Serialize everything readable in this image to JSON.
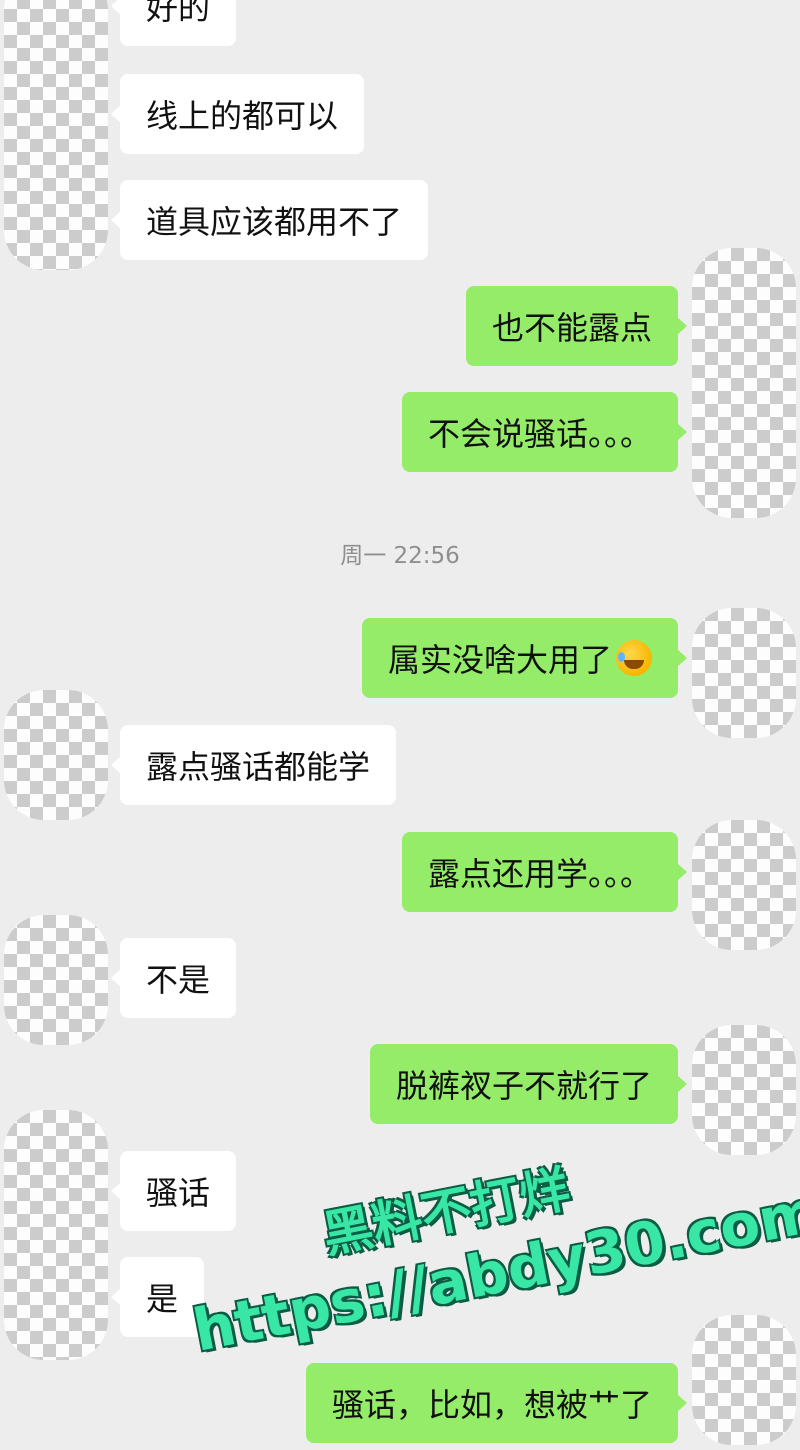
{
  "chat": {
    "messages": [
      {
        "side": "in",
        "text": "好的"
      },
      {
        "side": "in",
        "text": "线上的都可以"
      },
      {
        "side": "in",
        "text": "道具应该都用不了"
      },
      {
        "side": "out",
        "text": "也不能露点"
      },
      {
        "side": "out",
        "text": "不会说骚话。。。"
      },
      {
        "side": "out",
        "text": "属实没啥大用了",
        "emoji": "laughing-crying-emoji"
      },
      {
        "side": "in",
        "text": "露点骚话都能学"
      },
      {
        "side": "out",
        "text": "露点还用学。。。"
      },
      {
        "side": "in",
        "text": "不是"
      },
      {
        "side": "out",
        "text": "脱裤衩子不就行了"
      },
      {
        "side": "in",
        "text": "骚话"
      },
      {
        "side": "in",
        "text": "是"
      },
      {
        "side": "out",
        "text": "骚话，比如，想被艹了"
      }
    ],
    "timestamp": "周一 22:56"
  },
  "colors": {
    "background": "#ededed",
    "incoming_bubble": "#ffffff",
    "outgoing_bubble": "#95ec69",
    "timestamp_text": "#8f8f8f",
    "watermark": "#38e6a6"
  },
  "watermark": {
    "line1": "黑料不打烊",
    "line2": "https://abdy30.com"
  }
}
